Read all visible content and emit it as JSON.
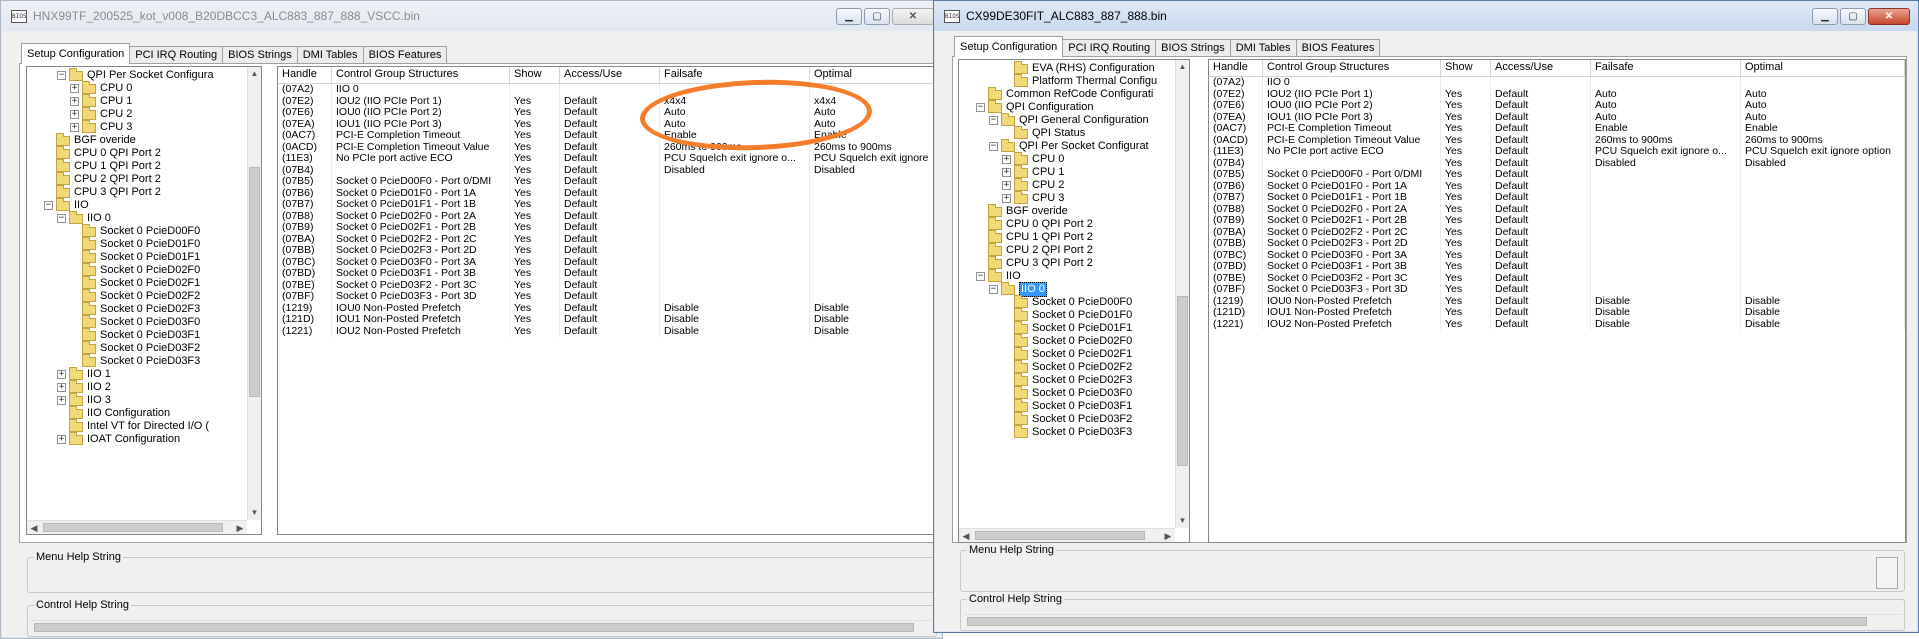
{
  "left_window": {
    "title": "HNX99TF_200525_kot_v008_B20DBCC3_ALC883_887_888_VSCC.bin",
    "icon_text": "BIOS",
    "tabs": [
      "Setup Configuration",
      "PCI IRQ Routing",
      "BIOS Strings",
      "DMI Tables",
      "BIOS Features"
    ],
    "active_tab": 0,
    "tree": [
      {
        "indent": 2,
        "expander": "−",
        "label": "QPI Per Socket Configura"
      },
      {
        "indent": 3,
        "expander": "+",
        "label": "CPU 0"
      },
      {
        "indent": 3,
        "expander": "+",
        "label": "CPU 1"
      },
      {
        "indent": 3,
        "expander": "+",
        "label": "CPU 2"
      },
      {
        "indent": 3,
        "expander": "+",
        "label": "CPU 3"
      },
      {
        "indent": 1,
        "expander": "",
        "label": "BGF overide"
      },
      {
        "indent": 1,
        "expander": "",
        "label": "CPU 0 QPI Port 2"
      },
      {
        "indent": 1,
        "expander": "",
        "label": "CPU 1 QPI Port 2"
      },
      {
        "indent": 1,
        "expander": "",
        "label": "CPU 2 QPI Port 2"
      },
      {
        "indent": 1,
        "expander": "",
        "label": "CPU 3 QPI Port 2"
      },
      {
        "indent": 1,
        "expander": "−",
        "label": "IIO"
      },
      {
        "indent": 2,
        "expander": "−",
        "label": "IIO 0"
      },
      {
        "indent": 3,
        "expander": "",
        "label": "Socket 0 PcieD00F0"
      },
      {
        "indent": 3,
        "expander": "",
        "label": "Socket 0 PcieD01F0"
      },
      {
        "indent": 3,
        "expander": "",
        "label": "Socket 0 PcieD01F1"
      },
      {
        "indent": 3,
        "expander": "",
        "label": "Socket 0 PcieD02F0"
      },
      {
        "indent": 3,
        "expander": "",
        "label": "Socket 0 PcieD02F1"
      },
      {
        "indent": 3,
        "expander": "",
        "label": "Socket 0 PcieD02F2"
      },
      {
        "indent": 3,
        "expander": "",
        "label": "Socket 0 PcieD02F3"
      },
      {
        "indent": 3,
        "expander": "",
        "label": "Socket 0 PcieD03F0"
      },
      {
        "indent": 3,
        "expander": "",
        "label": "Socket 0 PcieD03F1"
      },
      {
        "indent": 3,
        "expander": "",
        "label": "Socket 0 PcieD03F2"
      },
      {
        "indent": 3,
        "expander": "",
        "label": "Socket 0 PcieD03F3"
      },
      {
        "indent": 2,
        "expander": "+",
        "label": "IIO 1"
      },
      {
        "indent": 2,
        "expander": "+",
        "label": "IIO 2"
      },
      {
        "indent": 2,
        "expander": "+",
        "label": "IIO 3"
      },
      {
        "indent": 2,
        "expander": "",
        "label": "IIO Configuration"
      },
      {
        "indent": 2,
        "expander": "",
        "label": "Intel VT for Directed I/O ("
      },
      {
        "indent": 2,
        "expander": "+",
        "label": "IOAT Configuration"
      }
    ],
    "columns": [
      "Handle",
      "Control Group Structures",
      "Show",
      "Access/Use",
      "Failsafe",
      "Optimal"
    ],
    "rows": [
      [
        "(07A2)",
        "IIO 0",
        "",
        "",
        "",
        ""
      ],
      [
        "(07E2)",
        "IOU2 (IIO PCIe Port 1)",
        "Yes",
        "Default",
        "x4x4",
        "x4x4"
      ],
      [
        "(07E6)",
        "IOU0 (IIO PCIe Port 2)",
        "Yes",
        "Default",
        "Auto",
        "Auto"
      ],
      [
        "(07EA)",
        "IOU1 (IIO PCIe Port 3)",
        "Yes",
        "Default",
        "Auto",
        "Auto"
      ],
      [
        "(0AC7)",
        "PCI-E Completion Timeout",
        "Yes",
        "Default",
        "Enable",
        "Enable"
      ],
      [
        "(0ACD)",
        "PCI-E Completion Timeout Value",
        "Yes",
        "Default",
        "260ms to 900ms",
        "260ms to 900ms"
      ],
      [
        "(11E3)",
        "No PCIe port active ECO",
        "Yes",
        "Default",
        "PCU Squelch exit ignore o...",
        "PCU Squelch exit ignore"
      ],
      [
        "(07B4)",
        "",
        "Yes",
        "Default",
        "Disabled",
        "Disabled"
      ],
      [
        "(07B5)",
        "Socket 0 PcieD00F0 - Port 0/DMI",
        "Yes",
        "Default",
        "",
        ""
      ],
      [
        "(07B6)",
        "Socket 0 PcieD01F0 - Port 1A",
        "Yes",
        "Default",
        "",
        ""
      ],
      [
        "(07B7)",
        "Socket 0 PcieD01F1 - Port 1B",
        "Yes",
        "Default",
        "",
        ""
      ],
      [
        "(07B8)",
        "Socket 0 PcieD02F0 - Port 2A",
        "Yes",
        "Default",
        "",
        ""
      ],
      [
        "(07B9)",
        "Socket 0 PcieD02F1 - Port 2B",
        "Yes",
        "Default",
        "",
        ""
      ],
      [
        "(07BA)",
        "Socket 0 PcieD02F2 - Port 2C",
        "Yes",
        "Default",
        "",
        ""
      ],
      [
        "(07BB)",
        "Socket 0 PcieD02F3 - Port 2D",
        "Yes",
        "Default",
        "",
        ""
      ],
      [
        "(07BC)",
        "Socket 0 PcieD03F0 - Port 3A",
        "Yes",
        "Default",
        "",
        ""
      ],
      [
        "(07BD)",
        "Socket 0 PcieD03F1 - Port 3B",
        "Yes",
        "Default",
        "",
        ""
      ],
      [
        "(07BE)",
        "Socket 0 PcieD03F2 - Port 3C",
        "Yes",
        "Default",
        "",
        ""
      ],
      [
        "(07BF)",
        "Socket 0 PcieD03F3 - Port 3D",
        "Yes",
        "Default",
        "",
        ""
      ],
      [
        "(1219)",
        "IOU0 Non-Posted Prefetch",
        "Yes",
        "Default",
        "Disable",
        "Disable"
      ],
      [
        "(121D)",
        "IOU1 Non-Posted Prefetch",
        "Yes",
        "Default",
        "Disable",
        "Disable"
      ],
      [
        "(1221)",
        "IOU2 Non-Posted Prefetch",
        "Yes",
        "Default",
        "Disable",
        "Disable"
      ]
    ],
    "menu_help_label": "Menu Help String",
    "control_help_label": "Control Help String"
  },
  "right_window": {
    "title": "CX99DE30FIT_ALC883_887_888.bin",
    "icon_text": "BIOS",
    "tabs": [
      "Setup Configuration",
      "PCI IRQ Routing",
      "BIOS Strings",
      "DMI Tables",
      "BIOS Features"
    ],
    "active_tab": 0,
    "tree": [
      {
        "indent": 3,
        "expander": "",
        "label": "EVA (RHS) Configuration"
      },
      {
        "indent": 3,
        "expander": "",
        "label": "Platform Thermal Configu"
      },
      {
        "indent": 1,
        "expander": "",
        "label": "Common RefCode Configurati"
      },
      {
        "indent": 1,
        "expander": "−",
        "label": "QPI Configuration"
      },
      {
        "indent": 2,
        "expander": "−",
        "label": "QPI General Configuration"
      },
      {
        "indent": 3,
        "expander": "",
        "label": "QPI Status"
      },
      {
        "indent": 2,
        "expander": "−",
        "label": "QPI Per Socket Configurat"
      },
      {
        "indent": 3,
        "expander": "+",
        "label": "CPU 0"
      },
      {
        "indent": 3,
        "expander": "+",
        "label": "CPU 1"
      },
      {
        "indent": 3,
        "expander": "+",
        "label": "CPU 2"
      },
      {
        "indent": 3,
        "expander": "+",
        "label": "CPU 3"
      },
      {
        "indent": 1,
        "expander": "",
        "label": "BGF overide"
      },
      {
        "indent": 1,
        "expander": "",
        "label": "CPU 0 QPI Port 2"
      },
      {
        "indent": 1,
        "expander": "",
        "label": "CPU 1 QPI Port 2"
      },
      {
        "indent": 1,
        "expander": "",
        "label": "CPU 2 QPI Port 2"
      },
      {
        "indent": 1,
        "expander": "",
        "label": "CPU 3 QPI Port 2"
      },
      {
        "indent": 1,
        "expander": "−",
        "label": "IIO"
      },
      {
        "indent": 2,
        "expander": "−",
        "label": "IIO 0",
        "selected": true
      },
      {
        "indent": 3,
        "expander": "",
        "label": "Socket 0 PcieD00F0"
      },
      {
        "indent": 3,
        "expander": "",
        "label": "Socket 0 PcieD01F0"
      },
      {
        "indent": 3,
        "expander": "",
        "label": "Socket 0 PcieD01F1"
      },
      {
        "indent": 3,
        "expander": "",
        "label": "Socket 0 PcieD02F0"
      },
      {
        "indent": 3,
        "expander": "",
        "label": "Socket 0 PcieD02F1"
      },
      {
        "indent": 3,
        "expander": "",
        "label": "Socket 0 PcieD02F2"
      },
      {
        "indent": 3,
        "expander": "",
        "label": "Socket 0 PcieD02F3"
      },
      {
        "indent": 3,
        "expander": "",
        "label": "Socket 0 PcieD03F0"
      },
      {
        "indent": 3,
        "expander": "",
        "label": "Socket 0 PcieD03F1"
      },
      {
        "indent": 3,
        "expander": "",
        "label": "Socket 0 PcieD03F2"
      },
      {
        "indent": 3,
        "expander": "",
        "label": "Socket 0 PcieD03F3"
      }
    ],
    "columns": [
      "Handle",
      "Control Group Structures",
      "Show",
      "Access/Use",
      "Failsafe",
      "Optimal"
    ],
    "rows": [
      [
        "(07A2)",
        "IIO 0",
        "",
        "",
        "",
        ""
      ],
      [
        "(07E2)",
        "IOU2 (IIO PCIe Port 1)",
        "Yes",
        "Default",
        "Auto",
        "Auto"
      ],
      [
        "(07E6)",
        "IOU0 (IIO PCIe Port 2)",
        "Yes",
        "Default",
        "Auto",
        "Auto"
      ],
      [
        "(07EA)",
        "IOU1 (IIO PCIe Port 3)",
        "Yes",
        "Default",
        "Auto",
        "Auto"
      ],
      [
        "(0AC7)",
        "PCI-E Completion Timeout",
        "Yes",
        "Default",
        "Enable",
        "Enable"
      ],
      [
        "(0ACD)",
        "PCI-E Completion Timeout Value",
        "Yes",
        "Default",
        "260ms to 900ms",
        "260ms to 900ms"
      ],
      [
        "(11E3)",
        "No PCIe port active ECO",
        "Yes",
        "Default",
        "PCU Squelch exit ignore o...",
        "PCU Squelch exit ignore option"
      ],
      [
        "(07B4)",
        "",
        "Yes",
        "Default",
        "Disabled",
        "Disabled"
      ],
      [
        "(07B5)",
        "Socket 0 PcieD00F0 - Port 0/DMI",
        "Yes",
        "Default",
        "",
        ""
      ],
      [
        "(07B6)",
        "Socket 0 PcieD01F0 - Port 1A",
        "Yes",
        "Default",
        "",
        ""
      ],
      [
        "(07B7)",
        "Socket 0 PcieD01F1 - Port 1B",
        "Yes",
        "Default",
        "",
        ""
      ],
      [
        "(07B8)",
        "Socket 0 PcieD02F0 - Port 2A",
        "Yes",
        "Default",
        "",
        ""
      ],
      [
        "(07B9)",
        "Socket 0 PcieD02F1 - Port 2B",
        "Yes",
        "Default",
        "",
        ""
      ],
      [
        "(07BA)",
        "Socket 0 PcieD02F2 - Port 2C",
        "Yes",
        "Default",
        "",
        ""
      ],
      [
        "(07BB)",
        "Socket 0 PcieD02F3 - Port 2D",
        "Yes",
        "Default",
        "",
        ""
      ],
      [
        "(07BC)",
        "Socket 0 PcieD03F0 - Port 3A",
        "Yes",
        "Default",
        "",
        ""
      ],
      [
        "(07BD)",
        "Socket 0 PcieD03F1 - Port 3B",
        "Yes",
        "Default",
        "",
        ""
      ],
      [
        "(07BE)",
        "Socket 0 PcieD03F2 - Port 3C",
        "Yes",
        "Default",
        "",
        ""
      ],
      [
        "(07BF)",
        "Socket 0 PcieD03F3 - Port 3D",
        "Yes",
        "Default",
        "",
        ""
      ],
      [
        "(1219)",
        "IOU0 Non-Posted Prefetch",
        "Yes",
        "Default",
        "Disable",
        "Disable"
      ],
      [
        "(121D)",
        "IOU1 Non-Posted Prefetch",
        "Yes",
        "Default",
        "Disable",
        "Disable"
      ],
      [
        "(1221)",
        "IOU2 Non-Posted Prefetch",
        "Yes",
        "Default",
        "Disable",
        "Disable"
      ]
    ],
    "menu_help_label": "Menu Help String",
    "control_help_label": "Control Help String"
  },
  "caption_buttons": {
    "minimize": "▁",
    "maximize": "▢",
    "close": "✕"
  },
  "icons": {
    "folder": "folder-icon",
    "expander": "tree-expander-icon",
    "annotation": "orange-hand-drawn-circle"
  },
  "colors": {
    "annotation": "#f57d2c",
    "selection": "#3399ff",
    "titlebar_active": "#c9d9ee"
  }
}
